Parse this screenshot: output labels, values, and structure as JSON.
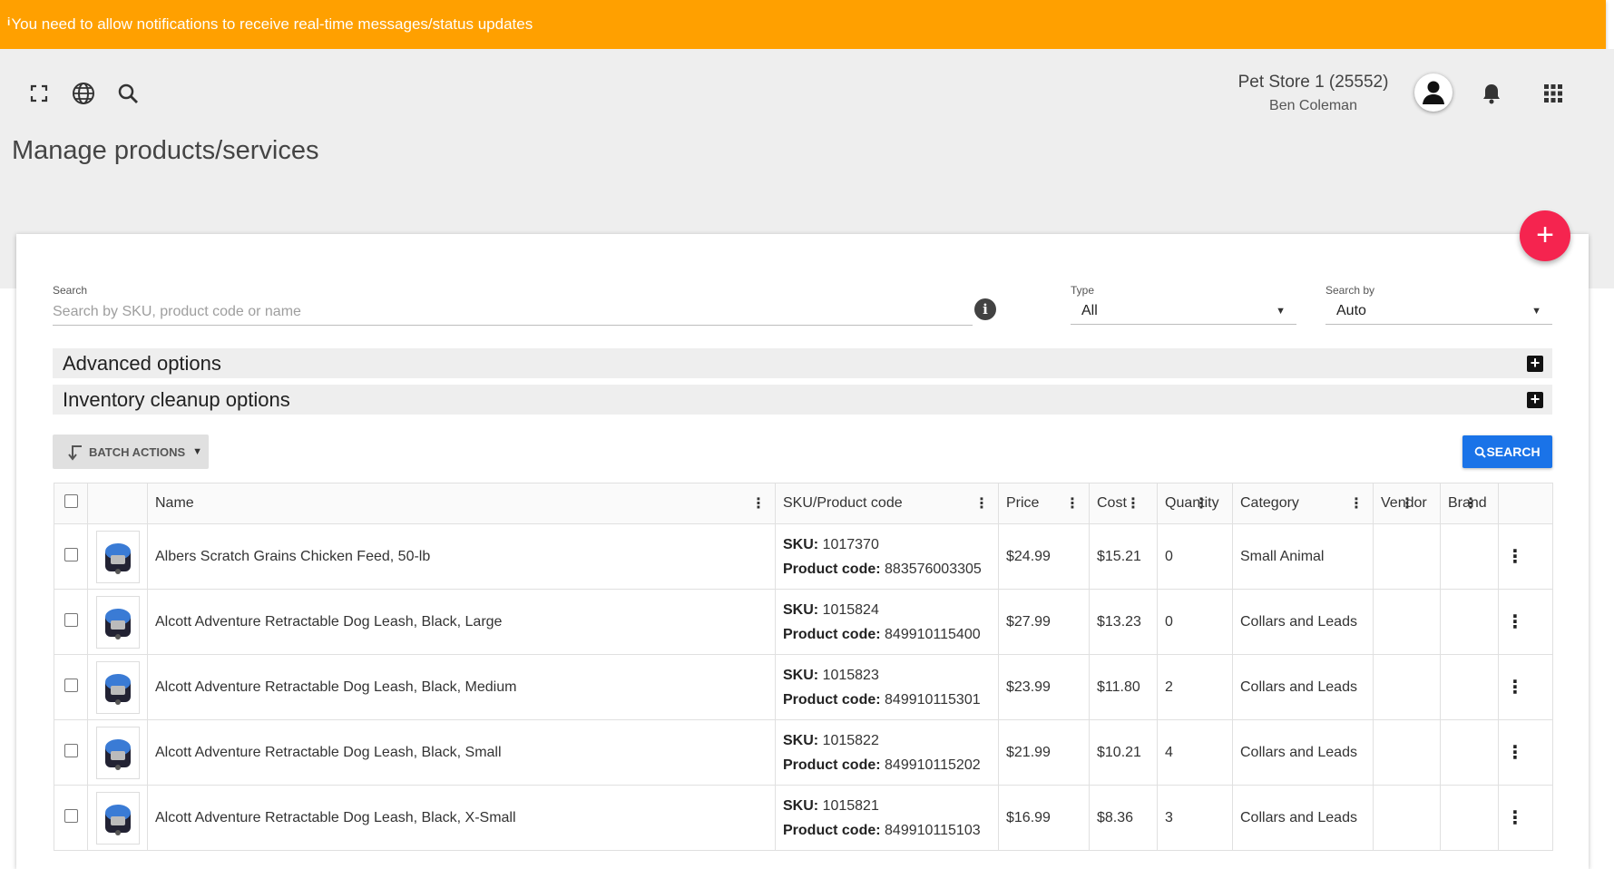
{
  "notification": {
    "icon": "info-icon",
    "text": "You need to allow notifications to receive real-time messages/status updates"
  },
  "header": {
    "store_name": "Pet Store 1 (25552)",
    "user_name": "Ben Coleman",
    "icons": [
      "fullscreen-icon",
      "globe-icon",
      "search-icon",
      "avatar-icon",
      "bell-icon",
      "apps-grid-icon"
    ]
  },
  "page": {
    "title": "Manage products/services"
  },
  "fab": {
    "label": "+"
  },
  "search": {
    "label": "Search",
    "placeholder": "Search by SKU, product code or name",
    "value": ""
  },
  "type_filter": {
    "label": "Type",
    "value": "All"
  },
  "search_by": {
    "label": "Search by",
    "value": "Auto"
  },
  "accordions": [
    {
      "label": "Advanced options"
    },
    {
      "label": "Inventory cleanup options"
    }
  ],
  "batch_actions": {
    "label": "BATCH ACTIONS"
  },
  "search_button": {
    "label": "SEARCH"
  },
  "table": {
    "columns": [
      "Name",
      "SKU/Product code",
      "Price",
      "Cost",
      "Quantity",
      "Category",
      "Vendor",
      "Brand"
    ],
    "sku_label": "SKU:",
    "code_label": "Product code:",
    "rows": [
      {
        "name": "Albers Scratch Grains Chicken Feed, 50-lb",
        "sku": "1017370",
        "code": "883576003305",
        "price": "$24.99",
        "cost": "$15.21",
        "qty": "0",
        "category": "Small Animal",
        "vendor": "",
        "brand": ""
      },
      {
        "name": "Alcott Adventure Retractable Dog Leash, Black, Large",
        "sku": "1015824",
        "code": "849910115400",
        "price": "$27.99",
        "cost": "$13.23",
        "qty": "0",
        "category": "Collars and Leads",
        "vendor": "",
        "brand": ""
      },
      {
        "name": "Alcott Adventure Retractable Dog Leash, Black, Medium",
        "sku": "1015823",
        "code": "849910115301",
        "price": "$23.99",
        "cost": "$11.80",
        "qty": "2",
        "category": "Collars and Leads",
        "vendor": "",
        "brand": ""
      },
      {
        "name": "Alcott Adventure Retractable Dog Leash, Black, Small",
        "sku": "1015822",
        "code": "849910115202",
        "price": "$21.99",
        "cost": "$10.21",
        "qty": "4",
        "category": "Collars and Leads",
        "vendor": "",
        "brand": ""
      },
      {
        "name": "Alcott Adventure Retractable Dog Leash, Black, X-Small",
        "sku": "1015821",
        "code": "849910115103",
        "price": "$16.99",
        "cost": "$8.36",
        "qty": "3",
        "category": "Collars and Leads",
        "vendor": "",
        "brand": ""
      }
    ]
  },
  "colors": {
    "banner": "#ffa000",
    "fab": "#f5244f",
    "primary_button": "#1a73e8"
  }
}
